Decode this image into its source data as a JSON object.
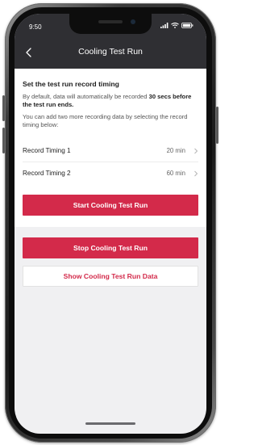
{
  "status_bar": {
    "time": "9:50",
    "icons": [
      "signal-icon",
      "wifi-icon",
      "battery-icon"
    ]
  },
  "header": {
    "title": "Cooling Test Run",
    "back_icon": "chevron-left-icon"
  },
  "record_section": {
    "title": "Set the test run record timing",
    "para1_prefix": "By default, data will automatically be recorded ",
    "para1_bold": "30 secs before the test run ends.",
    "para2": "You can add two more recording data by selecting the record timing below:",
    "timings": [
      {
        "label": "Record Timing 1",
        "value": "20 min"
      },
      {
        "label": "Record Timing 2",
        "value": "60 min"
      }
    ]
  },
  "buttons": {
    "start": "Start Cooling Test Run",
    "stop": "Stop Cooling Test Run",
    "show_data": "Show Cooling Test Run Data"
  },
  "colors": {
    "accent": "#d32a4a",
    "header_bg": "#2f2f33",
    "screen_bg": "#f0f0f2"
  }
}
